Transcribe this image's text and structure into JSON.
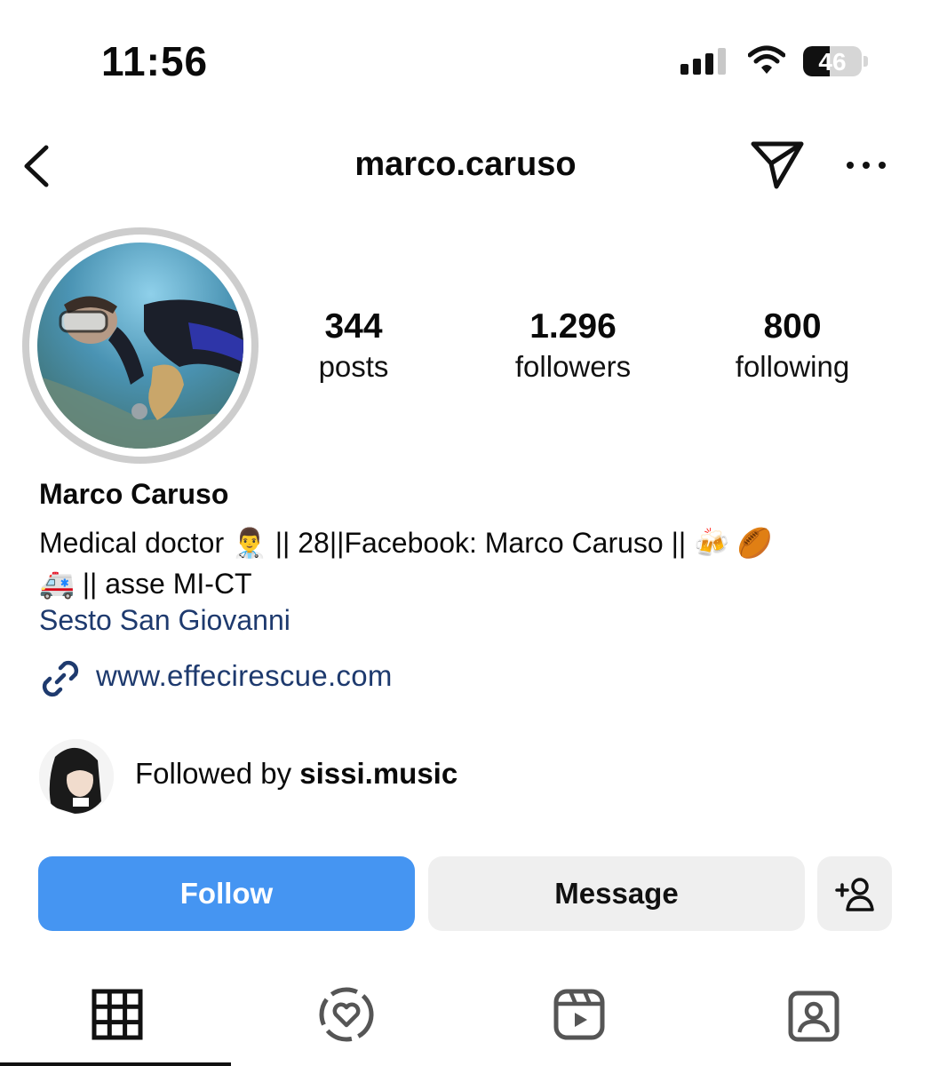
{
  "status_bar": {
    "time": "11:56",
    "battery_percent": "46",
    "battery_level": 0.46,
    "signal_bars_active": 3,
    "signal_bars_total": 4
  },
  "header": {
    "username": "marco.caruso",
    "icons": [
      "back-chevron-icon",
      "send-direct-icon",
      "more-options-icon"
    ]
  },
  "stats": {
    "posts": {
      "value": "344",
      "label": "posts"
    },
    "followers": {
      "value": "1.296",
      "label": "followers"
    },
    "following": {
      "value": "800",
      "label": "following"
    }
  },
  "profile": {
    "name": "Marco Caruso",
    "bio_line1_a": "Medical doctor",
    "bio_line1_b": "|| 28||Facebook: Marco Caruso ||",
    "bio_line2": "|| asse MI-CT",
    "emoji_doctor": "👨‍⚕️",
    "emoji_beers": "🍻",
    "emoji_football": "🏉",
    "emoji_ambulance": "🚑",
    "location": "Sesto San Giovanni",
    "link": "www.effecirescue.com"
  },
  "followed_by": {
    "prefix": "Followed by",
    "username": "sissi.music"
  },
  "actions": {
    "follow_label": "Follow",
    "message_label": "Message"
  },
  "tabs": [
    {
      "name": "grid",
      "icon": "grid-icon",
      "active": true
    },
    {
      "name": "highlights",
      "icon": "heart-circle-icon",
      "active": false
    },
    {
      "name": "reels",
      "icon": "reels-icon",
      "active": false
    },
    {
      "name": "tagged",
      "icon": "tagged-person-icon",
      "active": false
    }
  ],
  "colors": {
    "follow_button": "#4595f2",
    "secondary_button": "#efefef",
    "link_text": "#1e3a6e"
  }
}
